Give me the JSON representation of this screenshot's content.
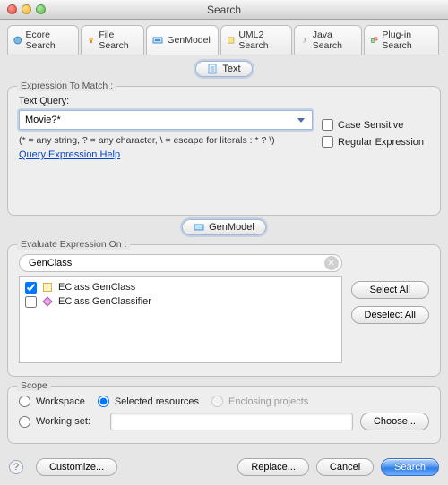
{
  "window": {
    "title": "Search"
  },
  "tabs": {
    "items": [
      {
        "label": "Ecore Search"
      },
      {
        "label": "File Search"
      },
      {
        "label": "GenModel"
      },
      {
        "label": "UML2 Search"
      },
      {
        "label": "Java Search"
      },
      {
        "label": "Plug-in Search"
      }
    ]
  },
  "text_pill": {
    "label": "Text"
  },
  "expr_group": {
    "title": "Expression To Match :",
    "query_label": "Text Query:",
    "query_value": "Movie?*",
    "hint": "(* = any string, ? = any character, \\ = escape for literals : * ? \\)",
    "help_link": "Query Expression Help",
    "case_sensitive": "Case Sensitive",
    "regex": "Regular Expression"
  },
  "genmodel_pill": {
    "label": "GenModel"
  },
  "eval_group": {
    "title": "Evaluate Expression On :",
    "filter_value": "GenClass",
    "items": [
      {
        "label": "EClass GenClass",
        "checked": true
      },
      {
        "label": "EClass GenClassifier",
        "checked": false
      }
    ],
    "select_all": "Select All",
    "deselect_all": "Deselect All"
  },
  "scope": {
    "title": "Scope",
    "workspace": "Workspace",
    "selected": "Selected resources",
    "enclosing": "Enclosing projects",
    "working_set": "Working set:",
    "choose": "Choose..."
  },
  "footer": {
    "customize": "Customize...",
    "replace": "Replace...",
    "cancel": "Cancel",
    "search": "Search"
  }
}
